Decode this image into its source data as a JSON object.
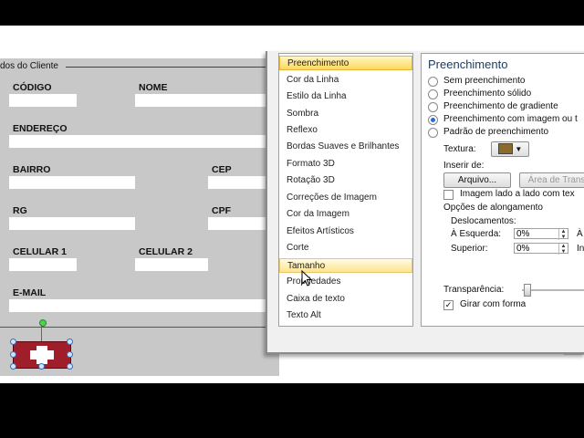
{
  "form": {
    "group_title": "dos do Cliente",
    "labels": {
      "codigo": "CÓDIGO",
      "nome": "NOME",
      "endereco": "ENDEREÇO",
      "bairro": "BAIRRO",
      "cep": "CEP",
      "rg": "RG",
      "cpf": "CPF",
      "celular1": "CELULAR 1",
      "celular2": "CELULAR 2",
      "email": "E-MAIL"
    },
    "add_button_icon": "plus-icon"
  },
  "dialog": {
    "categories": [
      "Preenchimento",
      "Cor da Linha",
      "Estilo da Linha",
      "Sombra",
      "Reflexo",
      "Bordas Suaves e Brilhantes",
      "Formato 3D",
      "Rotação 3D",
      "Correções de Imagem",
      "Cor da Imagem",
      "Efeitos Artísticos",
      "Corte",
      "Tamanho",
      "Propriedades",
      "Caixa de texto",
      "Texto Alt"
    ],
    "selected_category": "Preenchimento",
    "hovered_category": "Tamanho",
    "panel": {
      "title": "Preenchimento",
      "options": [
        "Sem preenchimento",
        "Preenchimento sólido",
        "Preenchimento de gradiente",
        "Preenchimento com imagem ou t",
        "Padrão de preenchimento"
      ],
      "selected_option_index": 3,
      "textura_label": "Textura:",
      "inserir_de": "Inserir de:",
      "arquivo_btn": "Arquivo...",
      "area_btn": "Área de Trans",
      "imagem_lado": "Imagem lado a lado com tex",
      "opcoes_along": "Opções de alongamento",
      "deslocamentos": "Deslocamentos:",
      "a_esquerda": "À Esquerda:",
      "a_esquerda_val": "0%",
      "a_dir_cut": "À",
      "superior": "Superior:",
      "superior_val": "0%",
      "inf_cut": "In",
      "transparencia": "Transparência:",
      "girar": "Girar com forma",
      "girar_checked": true
    }
  }
}
